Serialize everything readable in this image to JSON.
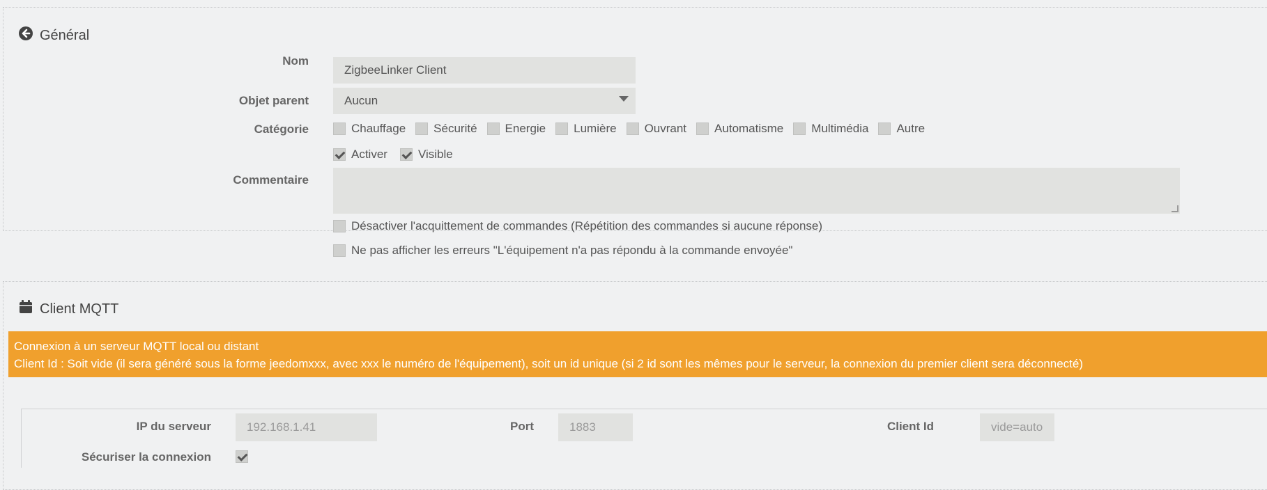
{
  "general": {
    "title": "Général",
    "nom_label": "Nom",
    "nom_value": "ZigbeeLinker Client",
    "parent_label": "Objet parent",
    "parent_value": "Aucun",
    "categorie_label": "Catégorie",
    "categories": [
      {
        "label": "Chauffage",
        "checked": false
      },
      {
        "label": "Sécurité",
        "checked": false
      },
      {
        "label": "Energie",
        "checked": false
      },
      {
        "label": "Lumière",
        "checked": false
      },
      {
        "label": "Ouvrant",
        "checked": false
      },
      {
        "label": "Automatisme",
        "checked": false
      },
      {
        "label": "Multimédia",
        "checked": false
      },
      {
        "label": "Autre",
        "checked": false
      }
    ],
    "activer_label": "Activer",
    "activer_checked": true,
    "visible_label": "Visible",
    "visible_checked": true,
    "commentaire_label": "Commentaire",
    "commentaire_value": "",
    "option1_label": "Désactiver l'acquittement de commandes (Répétition des commandes si aucune réponse)",
    "option2_label": "Ne pas afficher les erreurs \"L'équipement n'a pas répondu à la commande envoyée\""
  },
  "mqtt": {
    "title": "Client MQTT",
    "alert_line1": "Connexion à un serveur MQTT local ou distant",
    "alert_line2": "Client Id : Soit vide (il sera généré sous la forme jeedomxxx, avec xxx le numéro de l'équipement), soit un id unique (si 2 id sont les mêmes pour le serveur, la connexion du premier client sera déconnecté)",
    "ip_label": "IP du serveur",
    "ip_placeholder": "192.168.1.41",
    "port_label": "Port",
    "port_placeholder": "1883",
    "clientid_label": "Client Id",
    "clientid_placeholder": "vide=auto",
    "secure_label": "Sécuriser la connexion",
    "secure_checked": true
  },
  "colors": {
    "alert": "#f0a02d",
    "background": "#f0f1f2",
    "input": "#e1e2e0"
  }
}
